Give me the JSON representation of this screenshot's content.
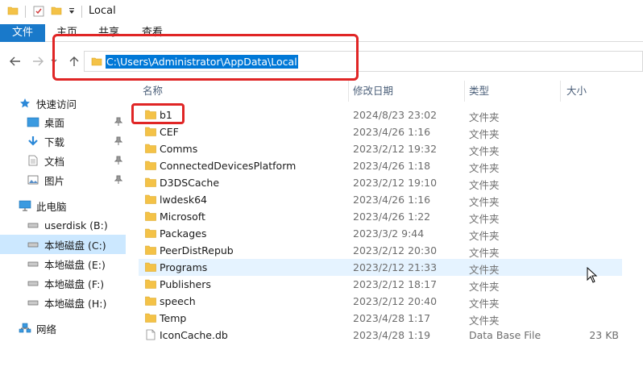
{
  "window": {
    "title": "Local"
  },
  "ribbon": {
    "tabs": [
      "文件",
      "主页",
      "共享",
      "查看"
    ]
  },
  "address": {
    "path": "C:\\Users\\Administrator\\AppData\\Local"
  },
  "sidebar": {
    "quick_access": "快速访问",
    "quick_items": [
      "桌面",
      "下载",
      "文档",
      "图片"
    ],
    "this_pc": "此电脑",
    "drives": [
      "userdisk (B:)",
      "本地磁盘 (C:)",
      "本地磁盘 (E:)",
      "本地磁盘 (F:)",
      "本地磁盘 (H:)"
    ],
    "network": "网络"
  },
  "columns": {
    "name": "名称",
    "modified": "修改日期",
    "type": "类型",
    "size": "大小"
  },
  "files": [
    {
      "name": "b1",
      "modified": "2024/8/23 23:02",
      "type": "文件夹",
      "size": ""
    },
    {
      "name": "CEF",
      "modified": "2023/4/26 1:16",
      "type": "文件夹",
      "size": ""
    },
    {
      "name": "Comms",
      "modified": "2023/2/12 19:32",
      "type": "文件夹",
      "size": ""
    },
    {
      "name": "ConnectedDevicesPlatform",
      "modified": "2023/4/26 1:18",
      "type": "文件夹",
      "size": ""
    },
    {
      "name": "D3DSCache",
      "modified": "2023/2/12 19:10",
      "type": "文件夹",
      "size": ""
    },
    {
      "name": "lwdesk64",
      "modified": "2023/4/26 1:16",
      "type": "文件夹",
      "size": ""
    },
    {
      "name": "Microsoft",
      "modified": "2023/4/26 1:22",
      "type": "文件夹",
      "size": ""
    },
    {
      "name": "Packages",
      "modified": "2023/3/2 9:44",
      "type": "文件夹",
      "size": ""
    },
    {
      "name": "PeerDistRepub",
      "modified": "2023/2/12 20:30",
      "type": "文件夹",
      "size": ""
    },
    {
      "name": "Programs",
      "modified": "2023/2/12 21:33",
      "type": "文件夹",
      "size": ""
    },
    {
      "name": "Publishers",
      "modified": "2023/2/12 18:17",
      "type": "文件夹",
      "size": ""
    },
    {
      "name": "speech",
      "modified": "2023/2/12 20:40",
      "type": "文件夹",
      "size": ""
    },
    {
      "name": "Temp",
      "modified": "2023/4/28 1:17",
      "type": "文件夹",
      "size": ""
    },
    {
      "name": "IconCache.db",
      "modified": "2023/4/28 1:19",
      "type": "Data Base File",
      "size": "23 KB"
    }
  ],
  "colors": {
    "accent": "#1979ca",
    "selection": "#0078d7",
    "highlight_box": "#e02525",
    "folder": "#f4c247"
  }
}
